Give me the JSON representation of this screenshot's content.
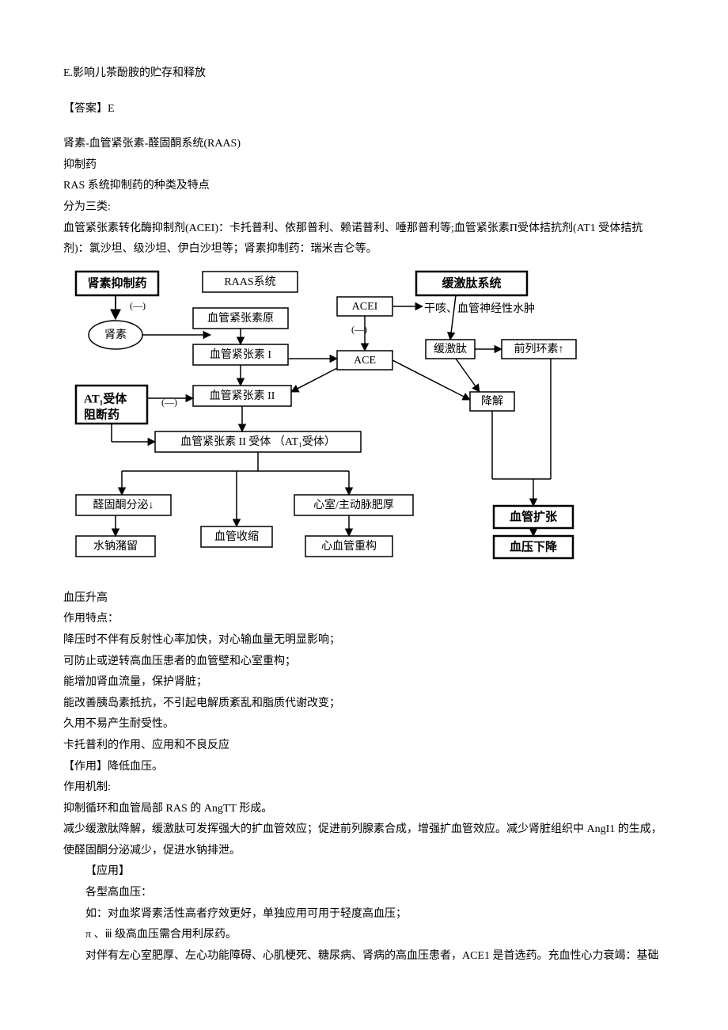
{
  "top": {
    "option_e": "E.影响儿茶酚胺的贮存和释放",
    "answer_label": "【答案】E"
  },
  "notes": {
    "line1": "肾素-血管紧张素-醛固酮系统(RAAS)",
    "line2": "抑制药",
    "line3": "RAS 系统抑制药的种类及特点",
    "line4": "分为三类:",
    "line5": "血管紧张素转化酶抑制剂(ACEI)：卡托普利、依那普利、赖诺普利、唾那普利等;血管紧张素Π受体拮抗剂(AT1 受体拮抗剂)：氯沙坦、级沙坦、伊白沙坦等；肾素抑制药：瑞米吉仑等。"
  },
  "diagram": {
    "renin_inhib": "肾素抑制药",
    "raas_sys": "RAAS系统",
    "bradykinin_sys": "缓激肽系统",
    "neg": "(—)",
    "angiotensinogen": "血管紧张素原",
    "acei": "ACEI",
    "cough_edema": "干咳、血管神经性水肿",
    "renin": "肾素",
    "ang1": "血管紧张素 I",
    "ace": "ACE",
    "bradykinin": "缓激肽",
    "prostacyclin": "前列环素↑",
    "at1_block1": "AT₁受体",
    "at1_block2": "阻断药",
    "ang2": "血管紧张素 II",
    "degrade": "降解",
    "ang2_receptor": "血管紧张素 II 受体 （AT₁受体）",
    "aldo_down": "醛固酮分泌↓",
    "vasoconstrict": "血管收缩",
    "lvh": "心室/主动脉肥厚",
    "vasodilate": "血管扩张",
    "na_retention": "水钠潴留",
    "remodel": "心血管重构",
    "bp_down": "血压下降"
  },
  "after": {
    "l0": "血压升高",
    "l1": "作用特点：",
    "l2": "降压时不伴有反射性心率加快，对心输血量无明显影响；",
    "l3": "可防止或逆转高血压患者的血管壁和心室重构；",
    "l4": "能增加肾血流量，保护肾脏；",
    "l5": "能改善胰岛素抵抗，不引起电解质紊乱和脂质代谢改变；",
    "l6": "久用不易产生耐受性。",
    "l7": "卡托普利的作用、应用和不良反应",
    "l8": "【作用】降低血压。",
    "l9": "作用机制:",
    "l10": "抑制循环和血管局部 RAS 的 AngTT 形成。",
    "l11": "减少缓激肽降解，缓激肽可发挥强大的扩血管效应；促进前列腺素合成，增强扩血管效应。减少肾脏组织中 AngI1 的生成，使醛固酮分泌减少，促进水钠排泄。",
    "l12": "【应用】",
    "l13": "各型高血压：",
    "l14": "如：对血浆肾素活性高者疗效更好，单独应用可用于轻度高血压；",
    "l15": "π 、ⅲ 级高血压需合用利尿药。",
    "l16": "对伴有左心室肥厚、左心功能障碍、心肌梗死、糖尿病、肾病的高血压患者，ACE1 是首选药。充血性心力衰竭：基础"
  }
}
